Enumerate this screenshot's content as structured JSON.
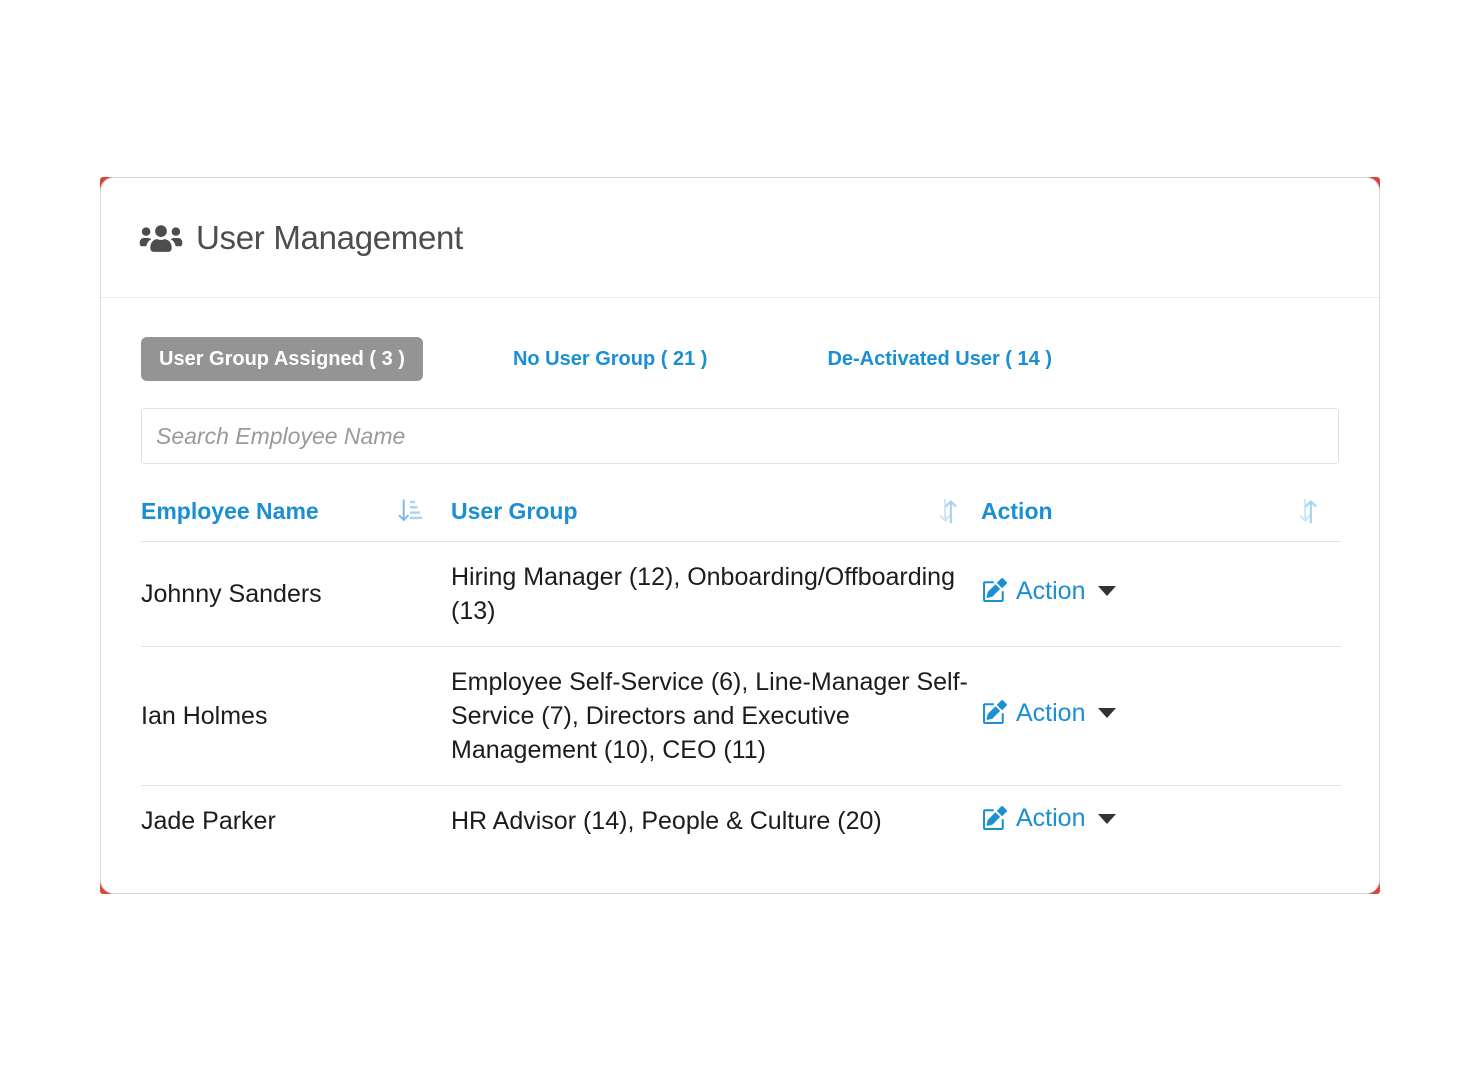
{
  "header": {
    "title": "User Management",
    "icon": "users-icon"
  },
  "tabs": [
    {
      "label": "User Group Assigned ( 3 )",
      "active": true,
      "name": "tab-user-group-assigned"
    },
    {
      "label": "No User Group ( 21 )",
      "active": false,
      "name": "tab-no-user-group"
    },
    {
      "label": "De-Activated User ( 14 )",
      "active": false,
      "name": "tab-deactivated-user"
    }
  ],
  "search": {
    "placeholder": "Search Employee Name",
    "value": ""
  },
  "table": {
    "columns": [
      {
        "label": "Employee Name",
        "sort_icon": "sort-amount-down-icon"
      },
      {
        "label": "User Group",
        "sort_icon": "sort-icon"
      },
      {
        "label": "Action",
        "sort_icon": "sort-icon"
      }
    ],
    "rows": [
      {
        "employee_name": "Johnny Sanders",
        "user_group": "Hiring Manager (12), Onboarding/Offboarding (13)",
        "action_label": "Action"
      },
      {
        "employee_name": "Ian Holmes",
        "user_group": "Employee Self-Service (6), Line-Manager Self-Service (7), Directors and Executive Management (10), CEO (11)",
        "action_label": "Action"
      },
      {
        "employee_name": "Jade Parker",
        "user_group": "HR Advisor (14), People & Culture (20)",
        "action_label": "Action"
      }
    ]
  },
  "colors": {
    "accent_blue": "#1b8fd3",
    "active_tab_bg": "#949494",
    "card_corner_accent": "#dc4437",
    "sort_icon_blue": "#a9d5ee",
    "title_gray": "#4d4d4d"
  }
}
